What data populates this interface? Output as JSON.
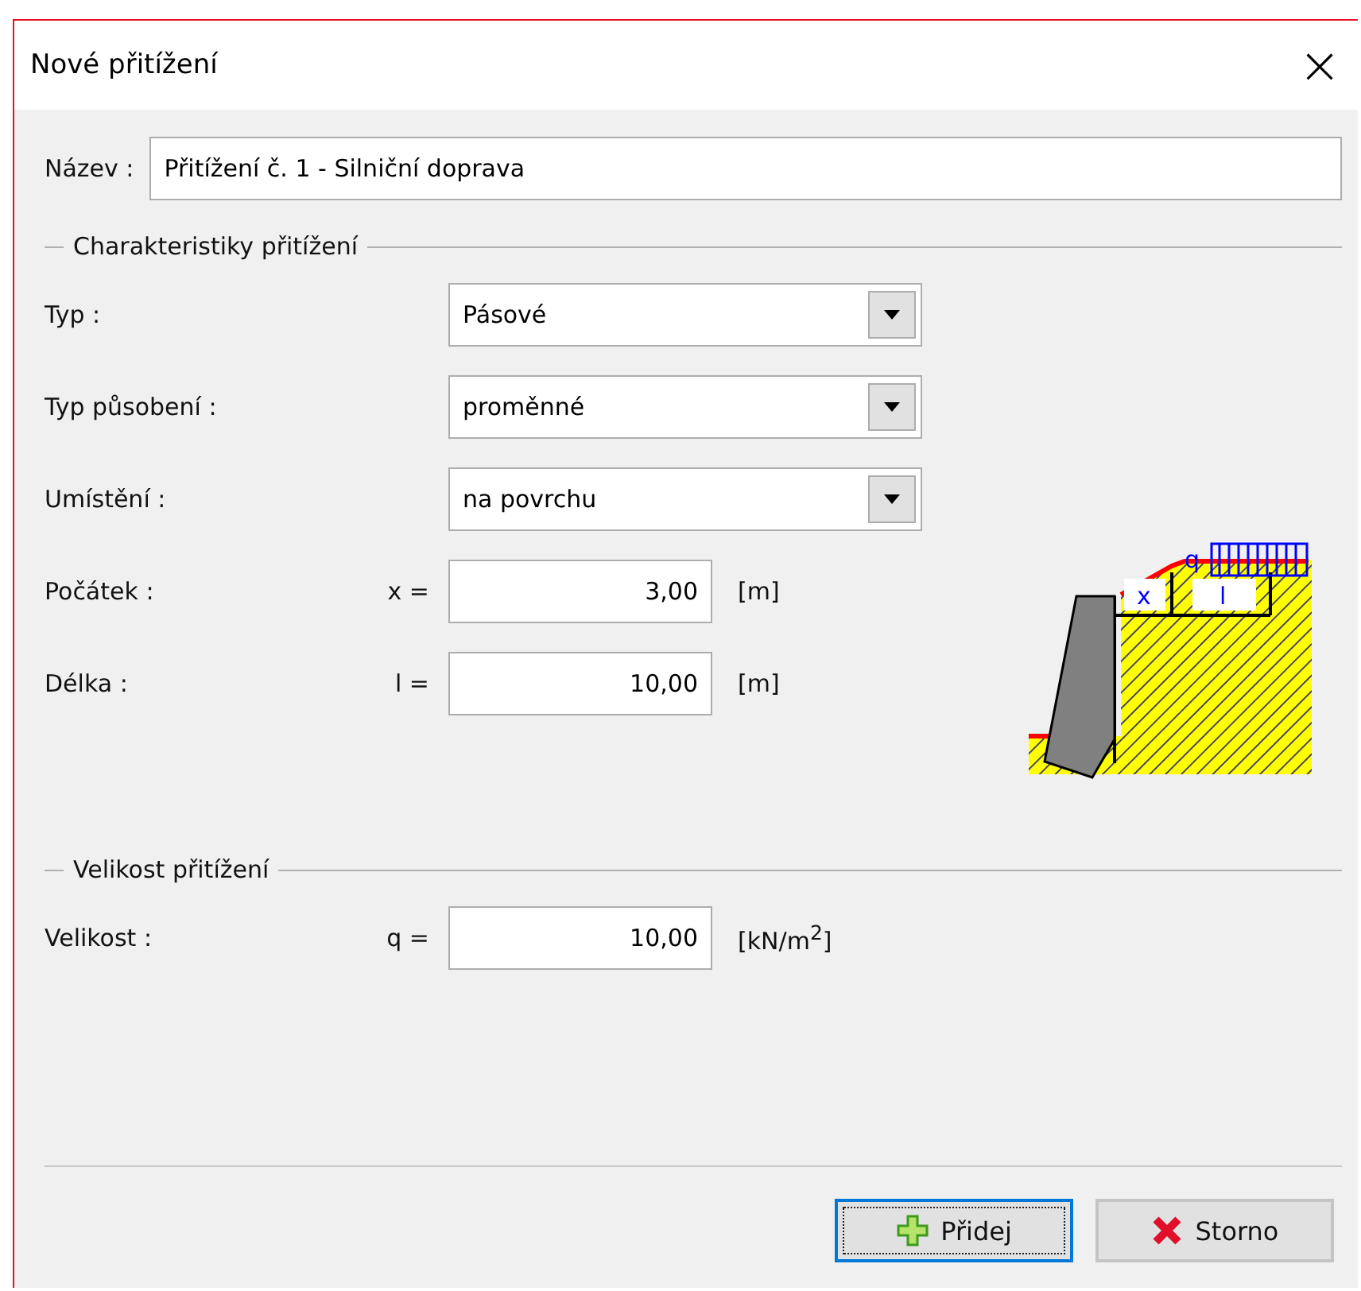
{
  "window": {
    "title": "Nové přitížení",
    "close": "×"
  },
  "name_field": {
    "label": "Název :",
    "value": "Přitížení č. 1 - Silniční doprava"
  },
  "characteristics": {
    "title": "Charakteristiky přitížení",
    "selects": [
      {
        "label": "Typ :",
        "value": "Pásové"
      },
      {
        "label": "Typ působení :",
        "value": "proměnné"
      },
      {
        "label": "Umístění :",
        "value": "na povrchu"
      }
    ],
    "inputs": [
      {
        "label": "Počátek :",
        "symbol": "x =",
        "value": "3,00",
        "unit": "[m]"
      },
      {
        "label": "Délka :",
        "symbol": "l =",
        "value": "10,00",
        "unit": "[m]"
      }
    ],
    "diagram": {
      "load_label": "q",
      "start_label": "x",
      "length_label": "l"
    }
  },
  "magnitude": {
    "title": "Velikost přitížení",
    "inputs": [
      {
        "label": "Velikost :",
        "symbol": "q =",
        "value": "10,00",
        "unit": "[kN/m$^{2}$]"
      }
    ]
  },
  "buttons": [
    {
      "label": "Přidej",
      "kind": "add",
      "focused": true
    },
    {
      "label": "Storno",
      "kind": "cancel",
      "focused": false
    }
  ]
}
